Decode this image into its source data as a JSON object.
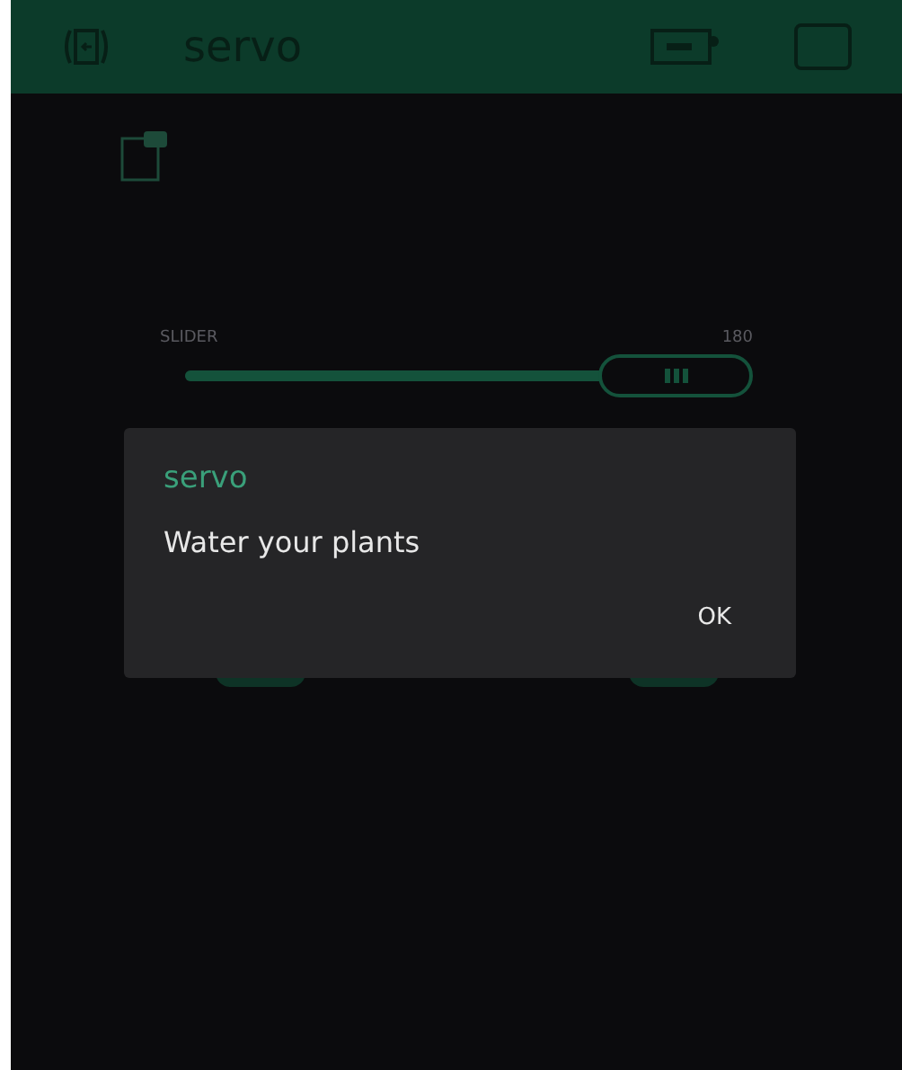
{
  "header": {
    "title": "servo"
  },
  "slider": {
    "label": "SLIDER",
    "reading": "180",
    "level": 1
  },
  "dialog": {
    "title": "servo",
    "message": "Water your plants",
    "buttons": [
      "OK"
    ]
  }
}
